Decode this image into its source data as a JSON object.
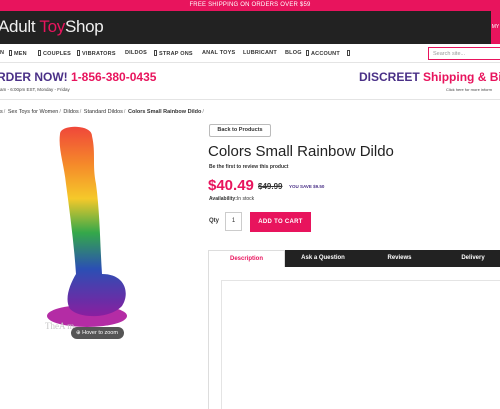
{
  "promo": {
    "text": "FREE SHIPPING ON ORDERS OVER $59"
  },
  "header": {
    "logo_part1": "Adult ",
    "logo_part2": "Toy",
    "logo_part3": "Shop",
    "right_label": "MY"
  },
  "nav": {
    "items": [
      {
        "label": "N"
      },
      {
        "label": "MEN"
      },
      {
        "label": "COUPLES"
      },
      {
        "label": "VIBRATORS"
      },
      {
        "label": "DILDOS"
      },
      {
        "label": "STRAP ONS"
      },
      {
        "label": "ANAL TOYS"
      },
      {
        "label": "LUBRICANT"
      },
      {
        "label": "BLOG"
      },
      {
        "label": "ACCOUNT"
      }
    ],
    "search_placeholder": "Search site..."
  },
  "banner": {
    "order_text": "RDER NOW!",
    "phone": "1-856-380-0435",
    "hours": "am - 6:00pm EST, Monday - Friday",
    "discreet": "DISCREET",
    "discreet_pink": "Shipping & Billi",
    "click_here": "Click here for more inform"
  },
  "breadcrumb": {
    "items": [
      "s",
      "Sex Toys for Women",
      "Dildos",
      "Standard Dildos"
    ],
    "current": "Colors Small Rainbow Dildo",
    "separator": "/"
  },
  "product": {
    "back_label": "Back to Products",
    "title": "Colors Small Rainbow Dildo",
    "review_link": "Be the first to review this product",
    "price": "$40.49",
    "old_price": "$49.99",
    "save": "YOU SAVE $9.50",
    "availability_label": "Availability:",
    "availability_value": "In stock",
    "qty_label": "Qty",
    "qty_value": "1",
    "add_to_cart": "ADD TO CART",
    "watermark": "TheA                    m",
    "hover_zoom": "Hover to zoom"
  },
  "tabs": [
    {
      "label": "Description"
    },
    {
      "label": "Ask a Question"
    },
    {
      "label": "Reviews"
    },
    {
      "label": "Delivery"
    }
  ],
  "colors": {
    "accent": "#e8145d",
    "brand_purple": "#4a3087",
    "header_bg": "#222222"
  }
}
